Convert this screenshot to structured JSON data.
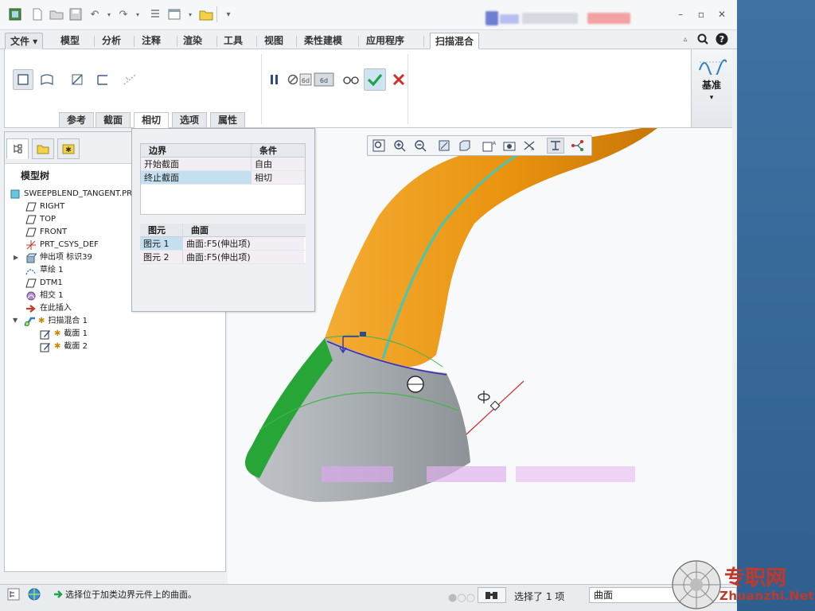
{
  "quick_access": {
    "icons": [
      "app-icon",
      "new-icon",
      "open-icon",
      "save-icon",
      "undo-icon",
      "redo-icon",
      "regenerate-icon",
      "windows-icon",
      "close-window-icon",
      "customize-icon"
    ]
  },
  "window": {
    "minimize": "–",
    "restore": "▫",
    "close": "✕"
  },
  "ribbon_tabs": [
    {
      "label": "文件 ▾"
    },
    {
      "label": "模型"
    },
    {
      "label": "分析"
    },
    {
      "label": "注释"
    },
    {
      "label": "渲染"
    },
    {
      "label": "工具"
    },
    {
      "label": "视图"
    },
    {
      "label": "柔性建模"
    },
    {
      "label": "应用程序"
    },
    {
      "label": "扫描混合"
    }
  ],
  "ribbon": {
    "datum_label": "基准",
    "datum_arrow": "▾",
    "subtabs": [
      "参考",
      "截面",
      "相切",
      "选项",
      "属性"
    ]
  },
  "model_tree": {
    "title": "模型树",
    "items": [
      {
        "label": "SWEEPBLEND_TANGENT.PRT"
      },
      {
        "label": "RIGHT"
      },
      {
        "label": "TOP"
      },
      {
        "label": "FRONT"
      },
      {
        "label": "PRT_CSYS_DEF"
      },
      {
        "label": "伸出项 标识39"
      },
      {
        "label": "草绘 1"
      },
      {
        "label": "DTM1"
      },
      {
        "label": "相交 1"
      },
      {
        "label": "在此插入"
      },
      {
        "label": "扫描混合 1"
      },
      {
        "label": "截面 1"
      },
      {
        "label": "截面 2"
      }
    ]
  },
  "tangent_panel": {
    "boundary_table": {
      "headers": [
        "边界",
        "条件"
      ],
      "rows": [
        [
          "开始截面",
          "自由"
        ],
        [
          "终止截面",
          "相切"
        ]
      ]
    },
    "element_table": {
      "headers": [
        "图元",
        "曲面"
      ],
      "rows": [
        [
          "图元 1",
          "曲面:F5(伸出项)"
        ],
        [
          "图元 2",
          "曲面:F5(伸出项)"
        ]
      ]
    }
  },
  "statusbar": {
    "message": "选择位于加类边界元件上的曲面。",
    "selection": "选择了 1 项",
    "filter": "曲面"
  },
  "watermark": {
    "cn": "专职网",
    "en": "Zhuanzhi.Net"
  },
  "colors": {
    "orange_body": "#e9930f",
    "green_face": "#27a537",
    "gray_face": "#9ea3a8",
    "cyan_curve": "#48c6b4",
    "accent_blue": "#2f7fc0",
    "accept_green": "#1fa34a",
    "cancel_red": "#d42a2a"
  }
}
